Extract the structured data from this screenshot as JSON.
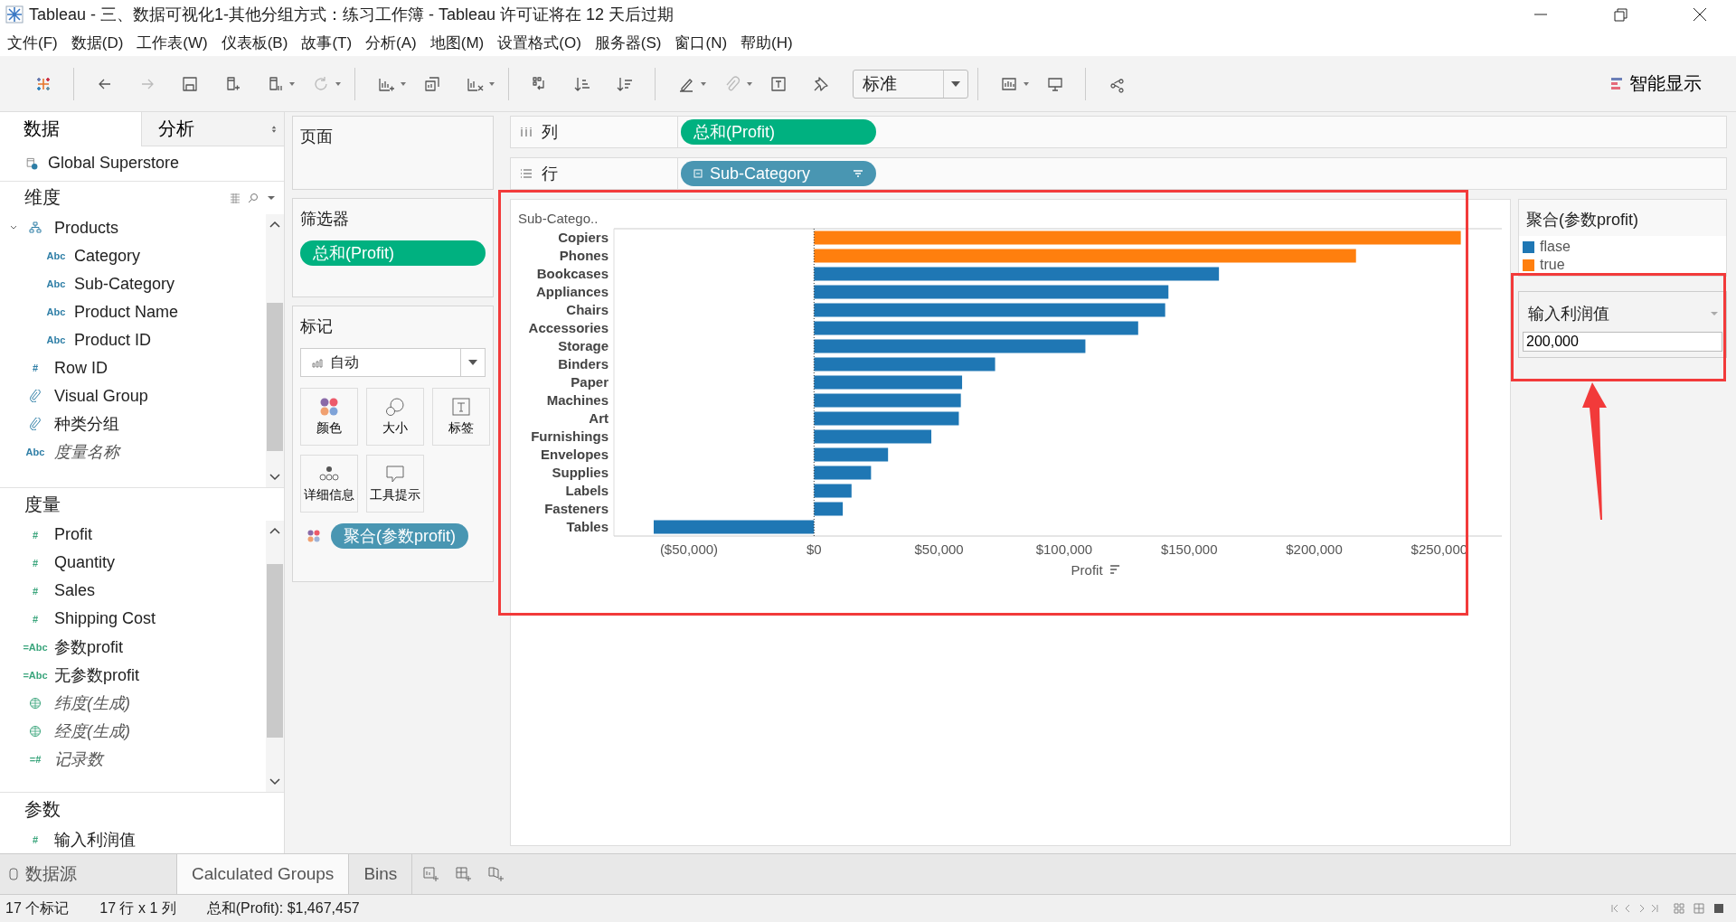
{
  "window": {
    "title": "Tableau - 三、数据可视化1-其他分组方式：练习工作簿 - Tableau 许可证将在 12 天后过期"
  },
  "menu": [
    "文件(F)",
    "数据(D)",
    "工作表(W)",
    "仪表板(B)",
    "故事(T)",
    "分析(A)",
    "地图(M)",
    "设置格式(O)",
    "服务器(S)",
    "窗口(N)",
    "帮助(H)"
  ],
  "toolbar": {
    "view_mode": "标准",
    "show_me": "智能显示"
  },
  "data_pane": {
    "tabs": [
      {
        "label": "数据",
        "selected": true
      },
      {
        "label": "分析",
        "selected": false
      }
    ],
    "data_source": "Global Superstore",
    "sections": [
      {
        "title": "维度",
        "items": [
          {
            "name": "Products",
            "kind": "hierarchy",
            "italic": false,
            "expanded": true,
            "children": [
              {
                "name": "Category",
                "kind": "text",
                "glyph": "Abc",
                "italic": false
              },
              {
                "name": "Sub-Category",
                "kind": "text",
                "glyph": "Abc",
                "italic": false
              },
              {
                "name": "Product Name",
                "kind": "text",
                "glyph": "Abc",
                "italic": false
              },
              {
                "name": "Product ID",
                "kind": "text",
                "glyph": "Abc",
                "italic": false
              }
            ]
          },
          {
            "name": "Row ID",
            "kind": "number",
            "glyph": "#",
            "italic": false
          },
          {
            "name": "Visual Group",
            "kind": "group",
            "italic": false
          },
          {
            "name": "种类分组",
            "kind": "group",
            "italic": false
          },
          {
            "name": "度量名称",
            "kind": "text",
            "glyph": "Abc",
            "italic": true
          }
        ]
      },
      {
        "title": "度量",
        "items": [
          {
            "name": "Profit",
            "kind": "number",
            "glyph": "#",
            "italic": false
          },
          {
            "name": "Quantity",
            "kind": "number",
            "glyph": "#",
            "italic": false
          },
          {
            "name": "Sales",
            "kind": "number",
            "glyph": "#",
            "italic": false
          },
          {
            "name": "Shipping Cost",
            "kind": "number",
            "glyph": "#",
            "italic": false
          },
          {
            "name": "参数profit",
            "kind": "calc-text",
            "glyph": "=Abc",
            "italic": false
          },
          {
            "name": "无参数profit",
            "kind": "calc-text",
            "glyph": "=Abc",
            "italic": false
          },
          {
            "name": "纬度(生成)",
            "kind": "geo",
            "italic": true
          },
          {
            "name": "经度(生成)",
            "kind": "geo",
            "italic": true
          },
          {
            "name": "记录数",
            "kind": "calc-number",
            "glyph": "=#",
            "italic": true
          }
        ]
      },
      {
        "title": "参数",
        "items": [
          {
            "name": "输入利润值",
            "kind": "number",
            "glyph": "#",
            "italic": false
          }
        ]
      }
    ]
  },
  "cards": {
    "pages": {
      "title": "页面"
    },
    "filters": {
      "title": "筛选器",
      "pills": [
        {
          "label": "总和(Profit)",
          "kind": "continuous"
        }
      ]
    },
    "marks": {
      "title": "标记",
      "mark_type": "自动",
      "buttons": [
        {
          "label": "颜色",
          "kind": "color"
        },
        {
          "label": "大小",
          "kind": "size"
        },
        {
          "label": "标签",
          "kind": "label"
        },
        {
          "label": "详细信息",
          "kind": "detail"
        },
        {
          "label": "工具提示",
          "kind": "tooltip"
        }
      ],
      "encodings": [
        {
          "label": "聚合(参数profit)",
          "kind": "discrete"
        }
      ]
    }
  },
  "shelves": [
    {
      "label": "列",
      "kind": "columns",
      "pill": {
        "label": "总和(Profit)",
        "kind": "continuous"
      }
    },
    {
      "label": "行",
      "kind": "rows",
      "pill": {
        "label": "Sub-Category",
        "kind": "discrete"
      }
    }
  ],
  "chart": {
    "chart_data": {
      "type": "bar",
      "orientation": "horizontal",
      "xlabel": "Profit",
      "ylabel": "Sub-Catego..",
      "categories": [
        "Copiers",
        "Phones",
        "Bookcases",
        "Appliances",
        "Chairs",
        "Accessories",
        "Storage",
        "Binders",
        "Paper",
        "Machines",
        "Art",
        "Furnishings",
        "Envelopes",
        "Supplies",
        "Labels",
        "Fasteners",
        "Tables"
      ],
      "series": [
        {
          "name": "flase",
          "color": "#1f77b4",
          "values": [
            null,
            null,
            161900,
            141700,
            140400,
            129600,
            108500,
            72400,
            59200,
            58700,
            57900,
            46900,
            29600,
            22800,
            15000,
            11500,
            -64100
          ]
        },
        {
          "name": "true",
          "color": "#ff7f0e",
          "values": [
            258600,
            216700,
            null,
            null,
            null,
            null,
            null,
            null,
            null,
            null,
            null,
            null,
            null,
            null,
            null,
            null,
            null
          ]
        }
      ],
      "xlim": [
        -80000,
        275000
      ],
      "xticks": [
        {
          "value": -50000,
          "label": "($50,000)"
        },
        {
          "value": 0,
          "label": "$0"
        },
        {
          "value": 50000,
          "label": "$50,000"
        },
        {
          "value": 100000,
          "label": "$100,000"
        },
        {
          "value": 150000,
          "label": "$150,000"
        },
        {
          "value": 200000,
          "label": "$200,000"
        },
        {
          "value": 250000,
          "label": "$250,000"
        }
      ]
    }
  },
  "legend": {
    "title": "聚合(参数profit)"
  },
  "parameter_control": {
    "title": "输入利润值",
    "value": "200,000"
  },
  "sheet_tabs": [
    {
      "label": "数据源",
      "kind": "datasource",
      "selected": false
    },
    {
      "label": "Calculated Groups",
      "kind": "sheet",
      "selected": true
    },
    {
      "label": "Bins",
      "kind": "sheet",
      "selected": false
    }
  ],
  "status_bar": [
    "17 个标记",
    "17 行 x 1 列",
    "总和(Profit): $1,467,457"
  ]
}
